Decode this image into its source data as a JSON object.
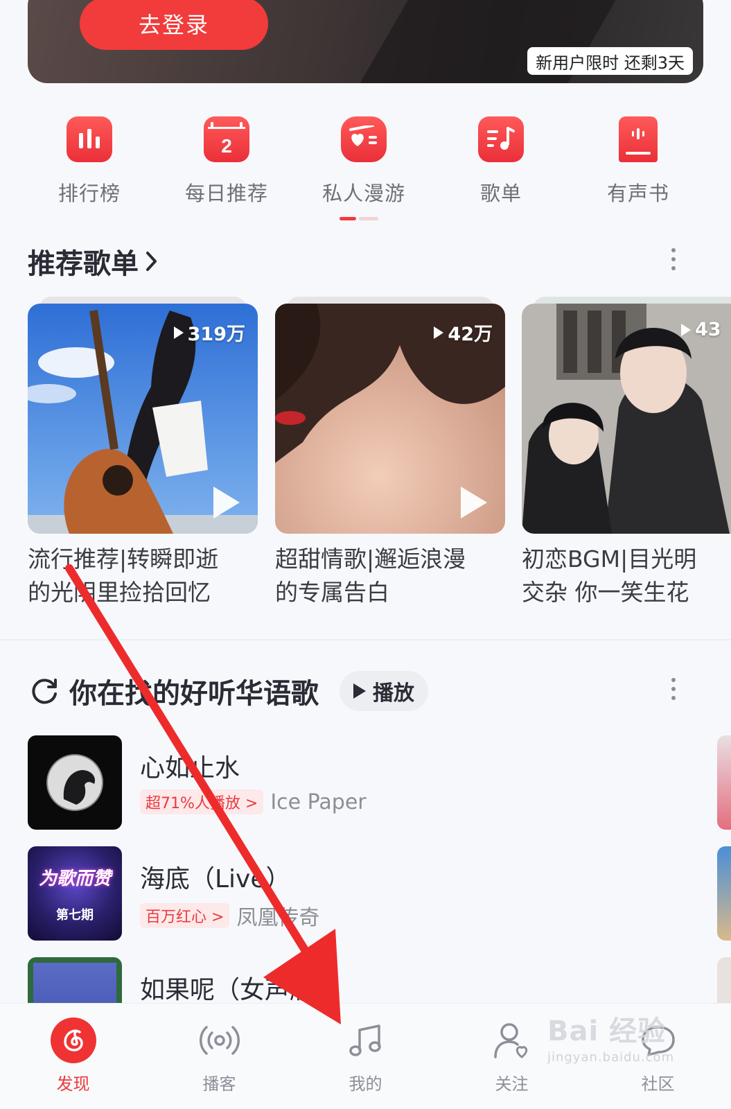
{
  "banner": {
    "login_label": "去登录",
    "promo_text": "新用户限时 还剩3天"
  },
  "shortcuts": [
    {
      "label": "排行榜",
      "icon": "chart-bars-icon"
    },
    {
      "label": "每日推荐",
      "icon": "calendar-icon",
      "badge": "2"
    },
    {
      "label": "私人漫游",
      "icon": "radio-heart-icon"
    },
    {
      "label": "歌单",
      "icon": "playlist-icon"
    },
    {
      "label": "有声书",
      "icon": "audiobook-icon"
    }
  ],
  "recommended": {
    "title": "推荐歌单",
    "cards": [
      {
        "plays": "319万",
        "title_line1": "流行推荐|转瞬即逝",
        "title_line2": "的光阴里捡拾回忆"
      },
      {
        "plays": "42万",
        "title_line1": "超甜情歌|邂逅浪漫",
        "title_line2": "的专属告白"
      },
      {
        "plays": "43",
        "title_line1": "初恋BGM|目光明",
        "title_line2": "交杂 你一笑生花"
      }
    ]
  },
  "songs_section": {
    "title": "你在找的好听华语歌",
    "play_label": "播放",
    "songs": [
      {
        "name": "心如止水",
        "tag": "超71%人播放 >",
        "artist": "Ice Paper"
      },
      {
        "name": "海底（Live）",
        "tag": "百万红心 >",
        "artist": "凤凰传奇"
      },
      {
        "name": "如果呢（女声版）",
        "tag": "",
        "artist": ""
      }
    ],
    "art2_text_top": "为歌而赞",
    "art2_text_bottom": "第七期"
  },
  "nav": [
    {
      "label": "发现",
      "icon": "netease-logo-icon",
      "active": true
    },
    {
      "label": "播客",
      "icon": "broadcast-icon",
      "active": false
    },
    {
      "label": "我的",
      "icon": "music-note-icon",
      "active": false
    },
    {
      "label": "关注",
      "icon": "follow-user-icon",
      "active": false
    },
    {
      "label": "社区",
      "icon": "community-chat-icon",
      "active": false
    }
  ],
  "watermark": {
    "text": "Bai 经验",
    "sub": "jingyan.baidu.com"
  },
  "colors": {
    "accent": "#f23b3b",
    "arrow": "#ee2b2b"
  }
}
